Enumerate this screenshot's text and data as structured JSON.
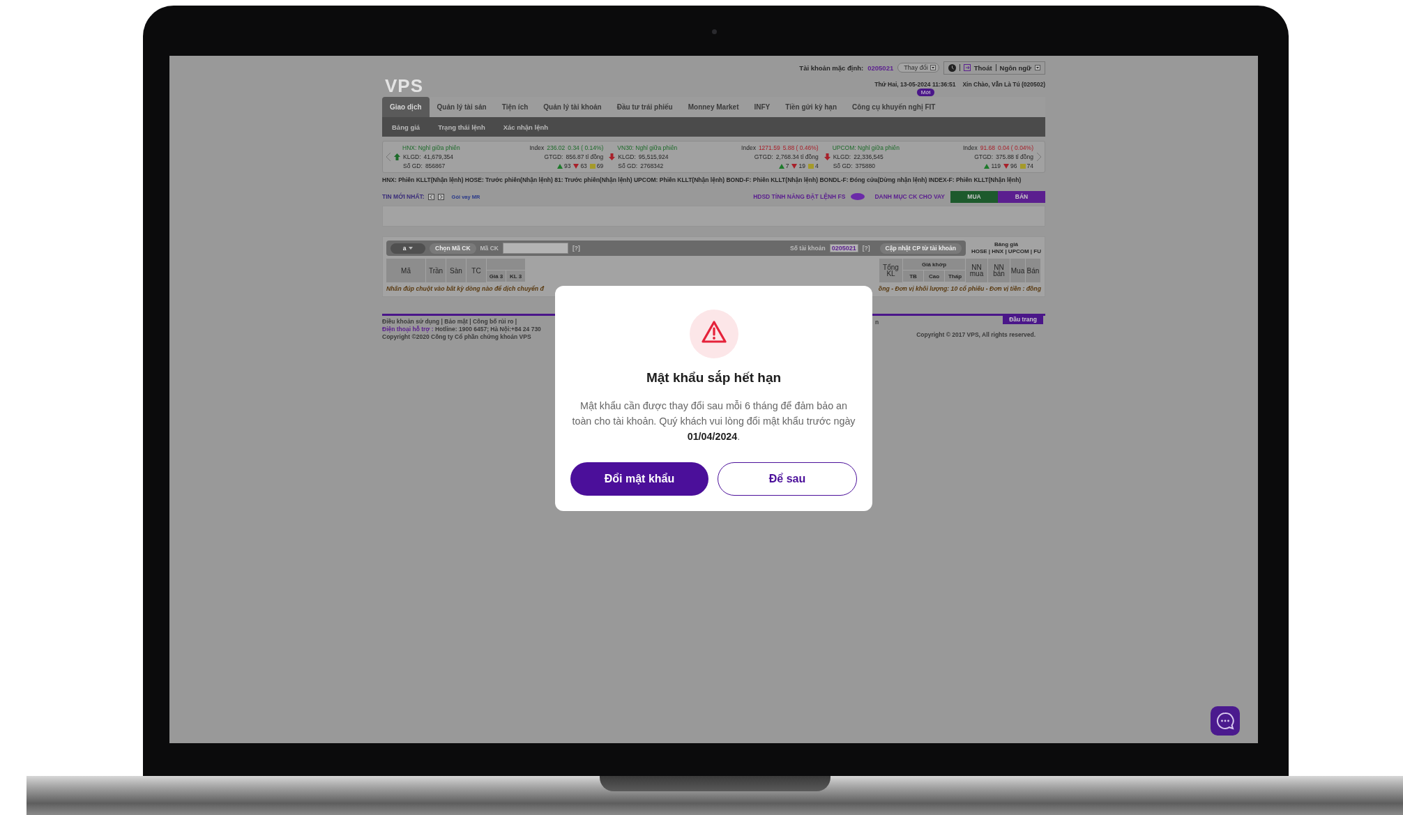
{
  "header": {
    "logo": "VPS",
    "account_label": "Tài khoản mặc định:",
    "account_number": "0205021",
    "change_button": "Thay đổi",
    "logout": "Thoát",
    "language": "Ngôn ngữ",
    "date": "Thứ Hai, 13-05-2024 11:36:51",
    "greeting": "Xin Chào, Vẫn Là Tú (020502)"
  },
  "main_tabs": [
    {
      "label": "Giao dịch",
      "selected": true
    },
    {
      "label": "Quản lý tài sản",
      "selected": false
    },
    {
      "label": "Tiện ích",
      "selected": false
    },
    {
      "label": "Quản lý tài khoản",
      "selected": false
    },
    {
      "label": "Đầu tư trái phiếu",
      "selected": false
    },
    {
      "label": "Monney Market",
      "selected": false
    },
    {
      "label": "INFY",
      "selected": false
    },
    {
      "label": "Tiền gửi kỳ hạn",
      "selected": false
    },
    {
      "label": "Công cụ khuyến nghị FIT",
      "selected": false,
      "badge": "Mới"
    }
  ],
  "sub_tabs": [
    {
      "label": "Bảng giá"
    },
    {
      "label": "Trạng thái lệnh"
    },
    {
      "label": "Xác nhận lệnh"
    }
  ],
  "market_indices": [
    {
      "name": "HNX: Nghỉ giữa phiên",
      "index_label": "Index",
      "index": "236.02",
      "change": "0.34 ( 0.14%)",
      "kind": "up",
      "color": "#1d6b2a",
      "klgd_label": "KLGD:",
      "klgd": "41,679,354",
      "gtgd_label": "GTGD:",
      "gtgd": "856.87 tỉ đồng",
      "so_gd_label": "Số GD:",
      "so_gd": "856867",
      "advances": "93",
      "declines": "63",
      "unchanged": "69"
    },
    {
      "name": "VN30: Nghỉ giữa phiên",
      "index_label": "Index",
      "index": "1271.59",
      "change": "5.88 ( 0.46%)",
      "kind": "down",
      "color": "#a8202a",
      "klgd_label": "KLGD:",
      "klgd": "95,515,924",
      "gtgd_label": "GTGD:",
      "gtgd": "2,768.34 tỉ đồng",
      "so_gd_label": "Số GD:",
      "so_gd": "2768342",
      "advances": "7",
      "declines": "19",
      "unchanged": "4"
    },
    {
      "name": "UPCOM: Nghỉ giữa phiên",
      "index_label": "Index",
      "index": "91.68",
      "change": "0.04 ( 0.04%)",
      "kind": "down",
      "color": "#a8202a",
      "klgd_label": "KLGD:",
      "klgd": "22,336,545",
      "gtgd_label": "GTGD:",
      "gtgd": "375.88 tỉ đồng",
      "so_gd_label": "Số GD:",
      "so_gd": "375880",
      "advances": "119",
      "declines": "96",
      "unchanged": "74"
    }
  ],
  "session_status": "HNX: Phiên KLLT(Nhận lệnh)   HOSE: Trước phiên(Nhận lệnh)   81: Trước phiên(Nhận lệnh)   UPCOM: Phiên KLLT(Nhận lệnh)   BOND-F: Phiên KLLT(Nhận lệnh)   BONDL-F: Đóng cửa(Dừng nhận lệnh)   INDEX-F: Phiên KLLT(Nhận lệnh)",
  "news": {
    "label": "TIN MỚI NHẤT:",
    "link": "Gói vay MR"
  },
  "actions": {
    "guide": "HDSD TÍNH NĂNG ĐẶT LỆNH FS",
    "margin_list": "DANH MỤC CK CHO VAY",
    "buy": "MUA",
    "sell": "BÁN"
  },
  "board_toolbar": {
    "dropdown": "a",
    "choose_button": "Chọn Mã CK",
    "symbol_label": "Mã CK",
    "help_1": "[?]",
    "account_label": "Số tài khoản",
    "account_number": "0205021",
    "help_2": "[?]",
    "update_button": "Cập nhật CP từ tài khoản",
    "board_label": "Bảng giá",
    "exchanges": "HOSE | HNX | UPCOM | FU"
  },
  "table": {
    "left_columns": [
      "Mã",
      "Trần",
      "Sàn",
      "TC"
    ],
    "left_sub_columns": [
      "Giá 3",
      "KL 3"
    ],
    "total_column": "Tổng KL",
    "match_group": "Giá khớp",
    "match_sub_columns": [
      "TB",
      "Cao",
      "Thấp"
    ],
    "right_columns": [
      "NN mua",
      "NN bán",
      "Mua",
      "Bán"
    ],
    "hint_left": "Nhấn đúp chuột vào bất kỳ dòng nào để dịch chuyển đ",
    "hint_right": "ồng - Đơn vị khối lượng: 10 cổ phiếu - Đơn vị tiền : đồng"
  },
  "footer": {
    "links": "Điều khoản sử dụng  |  Bảo mật  |  Công bố rủi ro  |",
    "fragment": "n",
    "support_label": "Điện thoại hỗ trợ :",
    "hotline": "Hotline: 1900 6457; Hà Nội:+84 24 730",
    "copyright_left": "Copyright ©2020 Công ty Cổ phần chứng khoán VPS",
    "top_button": "Đầu trang",
    "copyright_right": "Copyright © 2017 VPS, All rights reserved."
  },
  "dialog": {
    "title": "Mật khẩu sắp hết hạn",
    "message": "Mật khẩu cần được thay đổi sau mỗi 6 tháng để đảm bảo an toàn cho tài khoản. Quý khách vui lòng đổi mật khẩu trước ngày **01/04/2024**.",
    "buttons": [
      {
        "label": "Đổi mật khẩu",
        "kind": "primary"
      },
      {
        "label": "Để sau",
        "kind": "secondary"
      }
    ]
  }
}
